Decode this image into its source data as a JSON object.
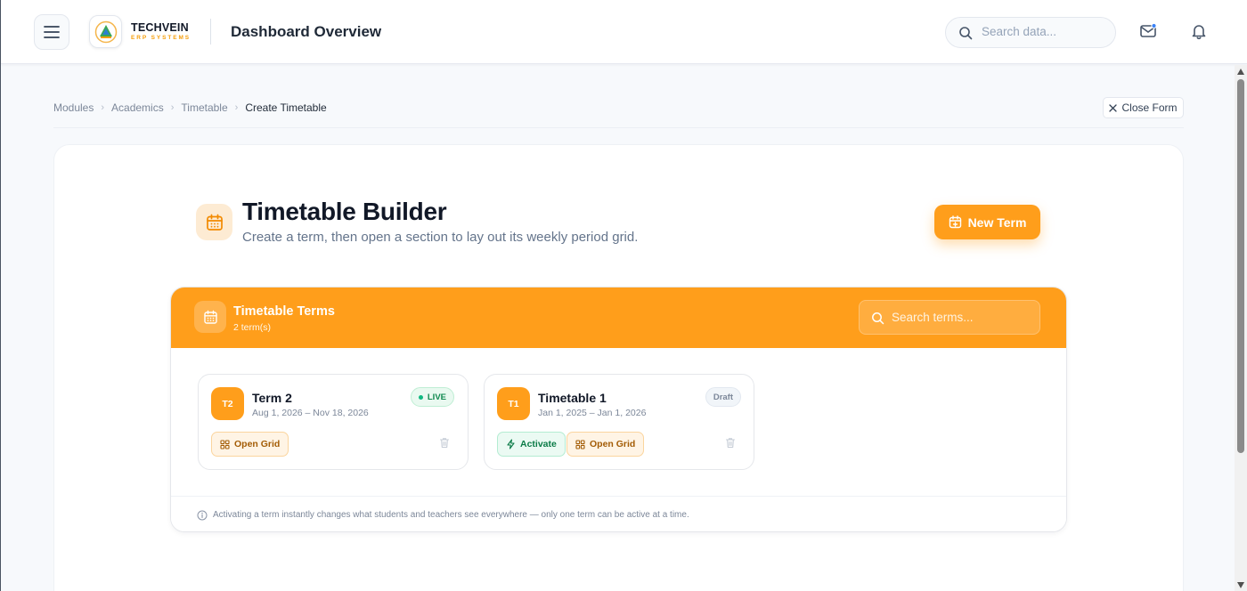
{
  "header": {
    "brand_name": "TECHVEIN",
    "brand_tagline": "ERP SYSTEMS",
    "page_title": "Dashboard Overview",
    "search_placeholder": "Search data...",
    "icons": [
      "menu-icon",
      "logo",
      "search-icon",
      "mail-icon",
      "bell-icon"
    ]
  },
  "breadcrumb": {
    "items": [
      "Modules",
      "Academics",
      "Timetable"
    ],
    "current": "Create Timetable"
  },
  "close_form_label": "Close Form",
  "hero": {
    "title": "Timetable Builder",
    "subtitle": "Create a term, then open a section to lay out its weekly period grid.",
    "new_term_label": "New Term"
  },
  "terms_panel": {
    "title": "Timetable Terms",
    "count_text": "2 term(s)",
    "search_placeholder": "Search terms...",
    "terms": [
      {
        "badge": "T2",
        "name": "Term 2",
        "dates": "Aug 1, 2026 – Nov 18, 2026",
        "status": "LIVE",
        "open_grid_label": "Open Grid"
      },
      {
        "badge": "T1",
        "name": "Timetable 1",
        "dates": "Jan 1, 2025 – Jan 1, 2026",
        "status": "Draft",
        "activate_label": "Activate",
        "open_grid_label": "Open Grid"
      }
    ],
    "footer_note": "Activating a term instantly changes what students and teachers see everywhere — only one term can be active at a time."
  },
  "colors": {
    "accent": "#ff9e1b",
    "live_green": "#10b981",
    "brand_text": "#111827",
    "tagline_orange": "#f59e0b"
  }
}
